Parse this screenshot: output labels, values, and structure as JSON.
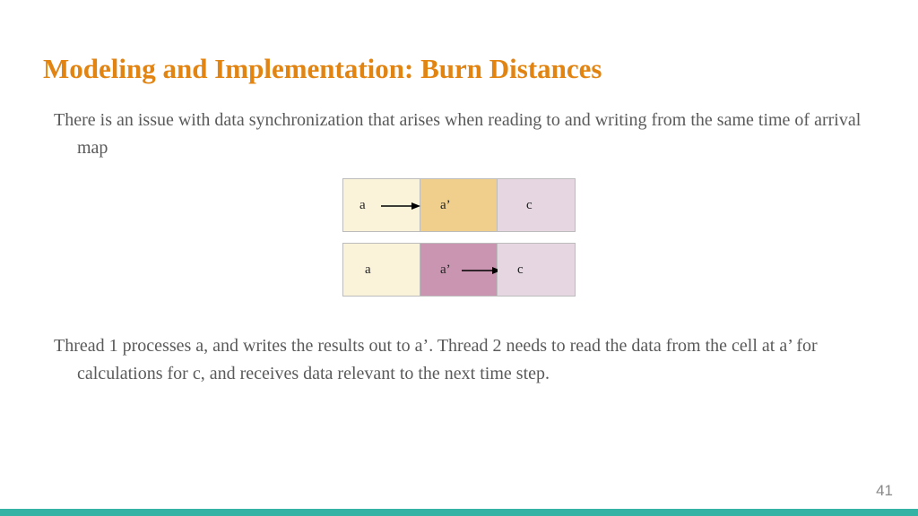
{
  "title": "Modeling and Implementation: Burn Distances",
  "para1": "There is an issue with data synchronization that arises when reading to and writing from the same time of arrival map",
  "para2": "Thread 1 processes a, and writes the results out to a’. Thread 2 needs to read the data from the cell at a’ for calculations for c, and receives data relevant to the next time step.",
  "rows": {
    "r1": {
      "a": "a",
      "b": "a’",
      "c": "c"
    },
    "r2": {
      "a": "a",
      "b": "a’",
      "c": "c"
    }
  },
  "page": "41"
}
